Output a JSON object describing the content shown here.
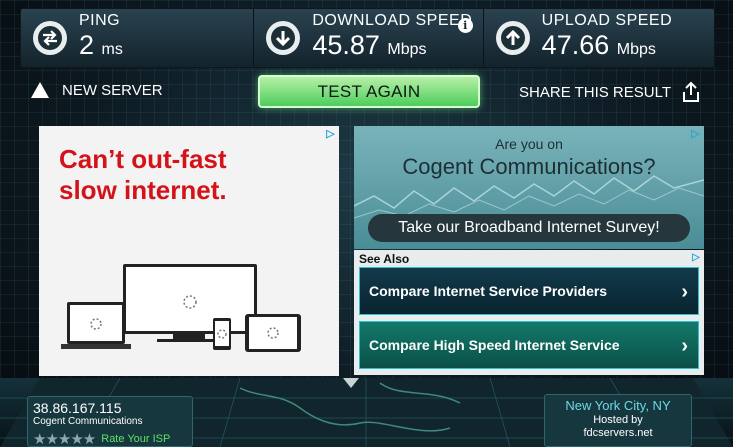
{
  "stats": {
    "ping": {
      "label": "PING",
      "value": "2",
      "unit": "ms",
      "icon": "ping-arrows-icon"
    },
    "download": {
      "label": "DOWNLOAD SPEED",
      "value": "45.87",
      "unit": "Mbps",
      "icon": "download-arrow-icon"
    },
    "upload": {
      "label": "UPLOAD SPEED",
      "value": "47.66",
      "unit": "Mbps",
      "icon": "upload-arrow-icon"
    },
    "info_glyph": "i"
  },
  "controls": {
    "new_server": "NEW SERVER",
    "test_again": "TEST AGAIN",
    "share": "SHARE THIS RESULT"
  },
  "ad_left": {
    "headline_line1": "Can’t out-fast",
    "headline_line2": "slow internet.",
    "adchoice": "▷"
  },
  "ad_right": {
    "question1": "Are you on",
    "question2": "Cogent Communications?",
    "survey_button": "Take our Broadband Internet Survey!",
    "adchoice": "▷"
  },
  "see_also": {
    "label": "See Also",
    "links": [
      {
        "label": "Compare Internet Service Providers"
      },
      {
        "label": "Compare High Speed Internet Service"
      }
    ],
    "chevron": "›",
    "adchoice": "▷"
  },
  "client": {
    "ip": "38.86.167.115",
    "isp": "Cogent Communications",
    "stars": "★★★★★",
    "rate_link": "Rate Your ISP"
  },
  "server": {
    "city": "New York City, NY",
    "hosted_by": "Hosted by",
    "host": "fdcservers.net"
  },
  "colors": {
    "accent_green": "#4dcd5c",
    "ad_red": "#d4121a",
    "city_cyan": "#6fd7e6"
  }
}
